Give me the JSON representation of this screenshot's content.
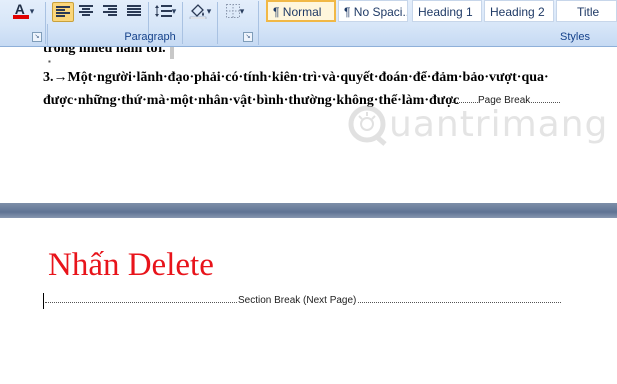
{
  "ribbon": {
    "font_color_glyph": "A",
    "dropdown_glyph": "▾",
    "paragraph_label": "Paragraph",
    "styles_label": "Styles",
    "launcher_glyph": "↘",
    "styles": [
      {
        "label": "¶ Normal",
        "selected": true
      },
      {
        "label": "¶ No Spaci...",
        "selected": false
      },
      {
        "label": "Heading 1",
        "selected": false
      },
      {
        "label": "Heading 2",
        "selected": false
      },
      {
        "label": "Title",
        "selected": false
      }
    ],
    "icons": [
      "font-color-icon",
      "align-left-icon",
      "align-center-icon",
      "align-right-icon",
      "justify-icon",
      "line-spacing-icon",
      "shading-icon",
      "borders-icon"
    ]
  },
  "document": {
    "partial_line": "trong nhiều năm tới.",
    "line1": "3.→Một·người·lãnh·đạo·phải·có·tính·kiên·trì·và·quyết·đoán·để·đảm·bảo·vượt·qua·",
    "line2": "được·những·thứ·mà·một·nhân·vật·bình·thường·không·thể·làm·được",
    "page_break_label": "Page Break",
    "big_text": "Nhấn Delete",
    "section_break_label": "Section Break (Next Page)"
  },
  "watermark": {
    "text": "uantrimang"
  },
  "colors": {
    "red_text": "#e8141b",
    "font_color_bar": "#e00000",
    "ribbon_bg": "#d7e6f8",
    "ribbon_label": "#15428b",
    "page_gap": "#6b7d9b"
  }
}
